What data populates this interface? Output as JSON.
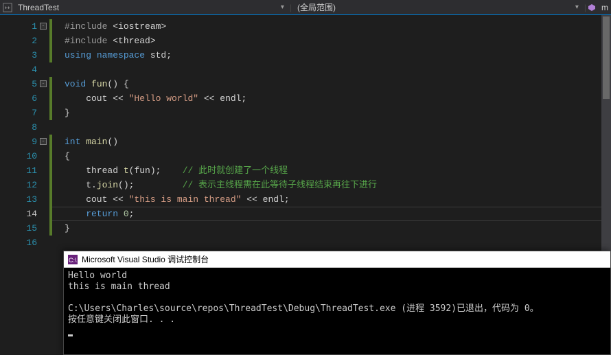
{
  "topbar": {
    "file_label": "ThreadTest",
    "scope_label": "(全局范围)",
    "right_marker": "m"
  },
  "code": {
    "lines": [
      {
        "n": 1,
        "fold": true,
        "bar": true,
        "tokens": [
          [
            "pp",
            "#include "
          ],
          [
            "punc",
            "<"
          ],
          [
            "id",
            "iostream"
          ],
          [
            "punc",
            ">"
          ]
        ]
      },
      {
        "n": 2,
        "bar": true,
        "nofold": true,
        "tokens": [
          [
            "pp",
            "#include "
          ],
          [
            "punc",
            "<"
          ],
          [
            "id",
            "thread"
          ],
          [
            "punc",
            ">"
          ]
        ]
      },
      {
        "n": 3,
        "bar": true,
        "tokens": [
          [
            "kw",
            "using "
          ],
          [
            "kw",
            "namespace "
          ],
          [
            "id",
            "std"
          ],
          [
            "punc",
            ";"
          ]
        ]
      },
      {
        "n": 4,
        "bar": false,
        "tokens": []
      },
      {
        "n": 5,
        "fold": true,
        "bar": true,
        "tokens": [
          [
            "ty",
            "void "
          ],
          [
            "fn",
            "fun"
          ],
          [
            "punc",
            "() {"
          ]
        ]
      },
      {
        "n": 6,
        "bar": true,
        "tokens": [
          [
            "id",
            "    cout "
          ],
          [
            "punc",
            "<< "
          ],
          [
            "str",
            "\"Hello world\""
          ],
          [
            "punc",
            " << "
          ],
          [
            "id",
            "endl"
          ],
          [
            "punc",
            ";"
          ]
        ]
      },
      {
        "n": 7,
        "bar": true,
        "tokens": [
          [
            "punc",
            "}"
          ]
        ]
      },
      {
        "n": 8,
        "bar": false,
        "tokens": []
      },
      {
        "n": 9,
        "fold": true,
        "bar": true,
        "tokens": [
          [
            "ty",
            "int "
          ],
          [
            "fn",
            "main"
          ],
          [
            "punc",
            "()"
          ]
        ]
      },
      {
        "n": 10,
        "bar": true,
        "tokens": [
          [
            "punc",
            "{"
          ]
        ]
      },
      {
        "n": 11,
        "bar": true,
        "tokens": [
          [
            "id",
            "    thread "
          ],
          [
            "fn",
            "t"
          ],
          [
            "punc",
            "("
          ],
          [
            "id",
            "fun"
          ],
          [
            "punc",
            ");"
          ],
          [
            "id",
            "    "
          ],
          [
            "cm",
            "// 此时就创建了一个线程"
          ]
        ]
      },
      {
        "n": 12,
        "bar": true,
        "tokens": [
          [
            "id",
            "    t."
          ],
          [
            "fn",
            "join"
          ],
          [
            "punc",
            "();"
          ],
          [
            "id",
            "         "
          ],
          [
            "cm",
            "// 表示主线程需在此等待子线程结束再往下进行"
          ]
        ]
      },
      {
        "n": 13,
        "bar": true,
        "tokens": [
          [
            "id",
            "    cout "
          ],
          [
            "punc",
            "<< "
          ],
          [
            "str",
            "\"this is main thread\""
          ],
          [
            "punc",
            " << "
          ],
          [
            "id",
            "endl"
          ],
          [
            "punc",
            ";"
          ]
        ]
      },
      {
        "n": 14,
        "bar": true,
        "current": true,
        "tokens": [
          [
            "kw",
            "    return "
          ],
          [
            "num",
            "0"
          ],
          [
            "punc",
            ";"
          ]
        ]
      },
      {
        "n": 15,
        "bar": true,
        "tokens": [
          [
            "punc",
            "}"
          ]
        ]
      },
      {
        "n": 16,
        "bar": false,
        "tokens": []
      }
    ]
  },
  "console": {
    "title": "Microsoft Visual Studio 调试控制台",
    "output": "Hello world\nthis is main thread\n\nC:\\Users\\Charles\\source\\repos\\ThreadTest\\Debug\\ThreadTest.exe (进程 3592)已退出，代码为 0。\n按任意键关闭此窗口. . ."
  }
}
